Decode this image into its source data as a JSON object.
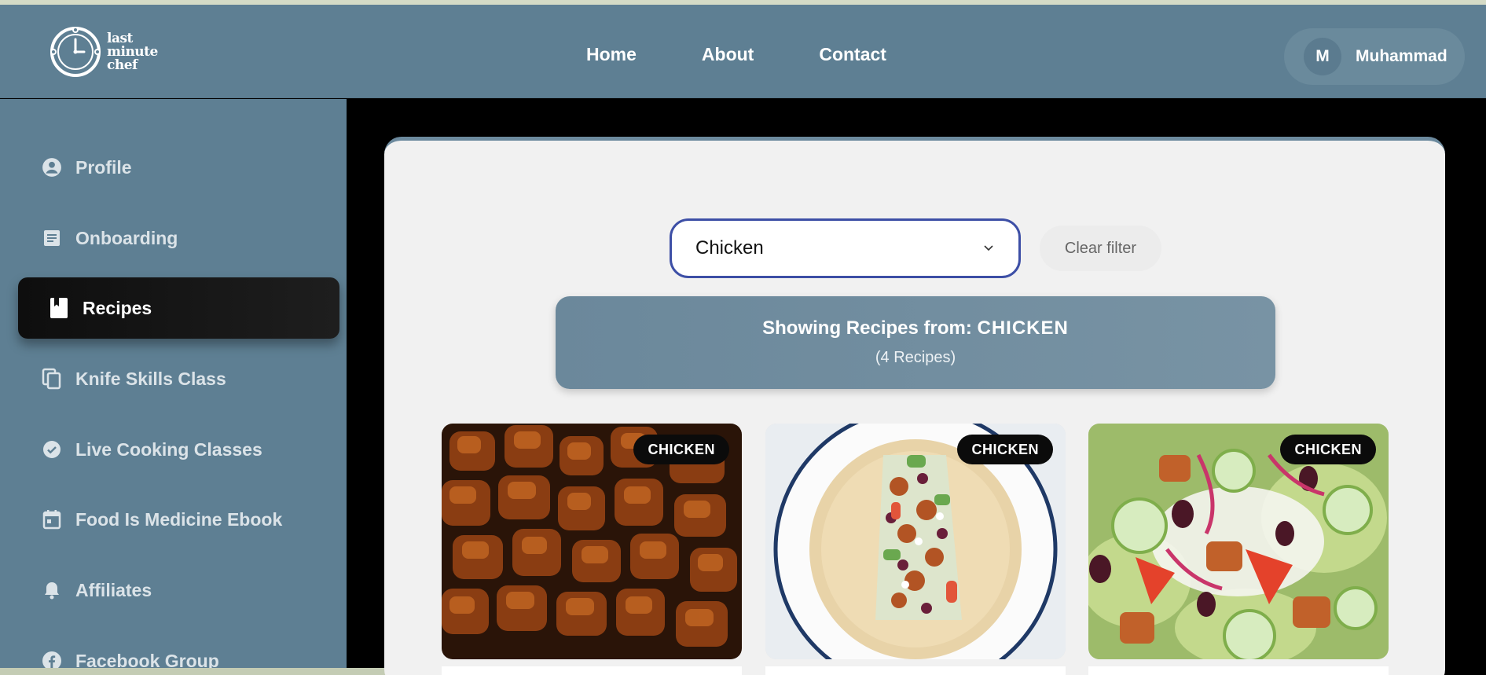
{
  "header": {
    "logo_lines": [
      "last",
      "minute",
      "chef"
    ],
    "nav": [
      "Home",
      "About",
      "Contact"
    ],
    "user": {
      "initial": "M",
      "name": "Muhammad"
    }
  },
  "sidebar": {
    "items": [
      {
        "label": "Profile",
        "icon": "account-circle-icon"
      },
      {
        "label": "Onboarding",
        "icon": "document-icon"
      },
      {
        "label": "Recipes",
        "icon": "book-icon",
        "active": true
      },
      {
        "label": "Knife Skills Class",
        "icon": "copy-icon"
      },
      {
        "label": "Live Cooking Classes",
        "icon": "check-circle-icon"
      },
      {
        "label": "Food Is Medicine Ebook",
        "icon": "calendar-icon"
      },
      {
        "label": "Affiliates",
        "icon": "bell-icon"
      },
      {
        "label": "Facebook Group",
        "icon": "facebook-icon"
      }
    ]
  },
  "filter": {
    "selected": "Chicken",
    "clear_label": "Clear filter"
  },
  "banner": {
    "prefix": "Showing Recipes from: ",
    "category": "CHICKEN",
    "count": "(4 Recipes)"
  },
  "cards": [
    {
      "badge": "CHICKEN"
    },
    {
      "badge": "CHICKEN"
    },
    {
      "badge": "CHICKEN"
    }
  ],
  "colors": {
    "header_bg": "#5e7f93",
    "active_item_bg": "#111111",
    "select_border": "#3d4fa6",
    "banner_bg": "#7190a3"
  }
}
